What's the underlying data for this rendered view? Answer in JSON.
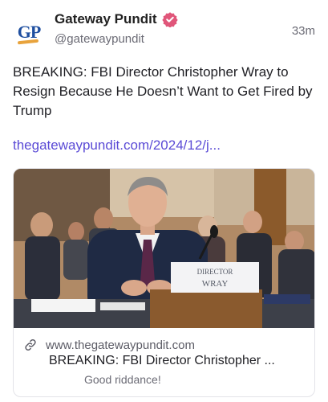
{
  "author": {
    "display_name": "Gateway Pundit",
    "handle": "@gatewaypundit",
    "avatar_text": "GP",
    "verified": true
  },
  "post": {
    "time": "33m",
    "text": "BREAKING: FBI Director Christopher Wray to Resign Because He Doesn’t Want to Get Fired by Trump",
    "link_text": "thegatewaypundit.com/2024/12/j..."
  },
  "card": {
    "domain": "www.thegatewaypundit.com",
    "title": "BREAKING: FBI Director Christopher ...",
    "description": "Good riddance!",
    "nameplate_line1": "DIRECTOR",
    "nameplate_line2": "WRAY"
  },
  "colors": {
    "accent_link": "#5b4bd6",
    "verified_badge": "#e0567a",
    "brand_blue": "#1f4fa0",
    "brand_orange": "#e8a33c"
  },
  "icons": {
    "verified": "verified-badge-icon",
    "link": "link-icon"
  }
}
